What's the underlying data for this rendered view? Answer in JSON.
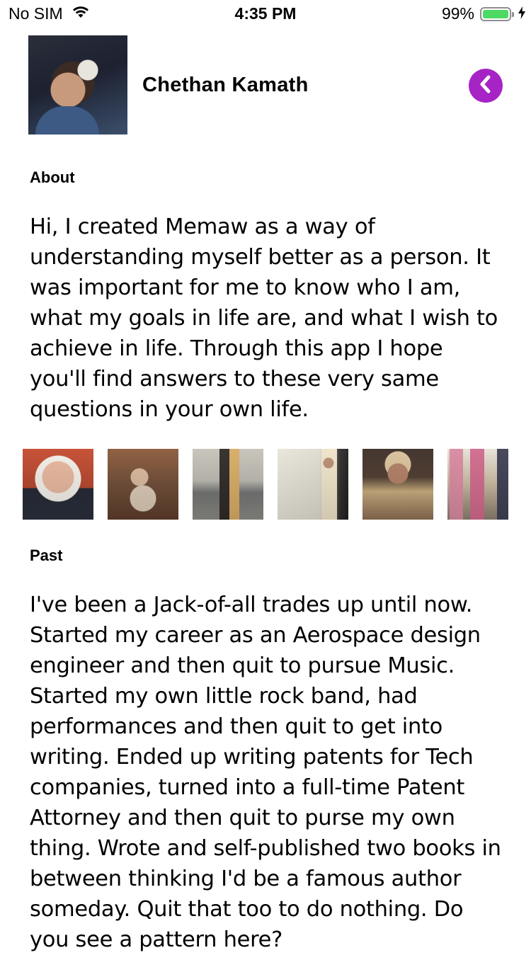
{
  "status_bar": {
    "carrier": "No SIM",
    "time": "4:35 PM",
    "battery_percent": "99%",
    "battery_level": 0.99,
    "battery_color": "#4cd964",
    "icons": [
      "wifi-icon",
      "battery-icon",
      "charging-bolt-icon"
    ]
  },
  "profile": {
    "name": "Chethan Kamath",
    "avatar_icon": "profile-photo"
  },
  "back_button": {
    "icon": "chevron-left-icon",
    "color": "#a624c5"
  },
  "about": {
    "heading": "About",
    "text": "Hi, I created Memaw as a way of understanding myself better as a person. It was important for me to know who I am, what my goals in life are, and what I wish to achieve in life. Through this app I hope you'll find answers to these very same questions in your own life."
  },
  "photos": [
    {
      "name": "photo-baby"
    },
    {
      "name": "photo-children-on-swing"
    },
    {
      "name": "photo-beach-couple"
    },
    {
      "name": "photo-boy-standing"
    },
    {
      "name": "photo-boy-costume"
    },
    {
      "name": "photo-group-kids"
    }
  ],
  "past": {
    "heading": "Past",
    "text": "I've been a Jack-of-all trades up until now. Started my career as an Aerospace design engineer and then quit to pursue Music. Started my own little rock band, had performances and then quit to get into writing. Ended up writing patents for Tech companies, turned into a full-time Patent Attorney and then quit to purse my own thing. Wrote and self-published two books in between thinking I'd be a famous author someday. Quit that too to do nothing. Do you see a pattern here?"
  }
}
